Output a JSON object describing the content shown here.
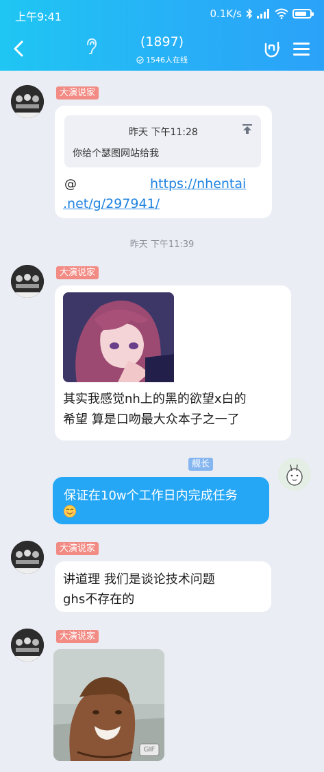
{
  "status": {
    "time": "上午9:41",
    "net_speed": "0.1K/s",
    "battery_level": 0.8
  },
  "header": {
    "title": "(1897)",
    "online": "1546人在线"
  },
  "colors": {
    "header": "#28aef7",
    "tag": "#f28b84",
    "tag_blue": "#86b6ef",
    "bubble_blue": "#26a7f6",
    "link": "#2083e0"
  },
  "messages": [
    {
      "sender_tag": "大演说家",
      "quote": {
        "time": "昨天 下午11:28",
        "text": "你给个瑟图网站给我"
      },
      "line1_prefix": "@",
      "link_line1": "https://nhentai",
      "link_line2": ".net/g/297941/"
    },
    {
      "divider": "昨天 下午11:39"
    },
    {
      "sender_tag": "大演说家",
      "image": "anime-girl-image",
      "line1": "其实我感觉nh上的黑的欲望x白的",
      "line2": "希望 算是口吻最大众本子之一了"
    },
    {
      "sender_tag": "舰长",
      "line1": "保证在10w个工作日内完成任务",
      "emoji": "smiling-face-emoji"
    },
    {
      "sender_tag": "大演说家",
      "line1": "讲道理 我们是谈论技术问题",
      "line2": "ghs不存在的"
    },
    {
      "sender_tag": "大演说家",
      "image": "smiling-man-gif",
      "gif_badge": "GIF"
    }
  ]
}
